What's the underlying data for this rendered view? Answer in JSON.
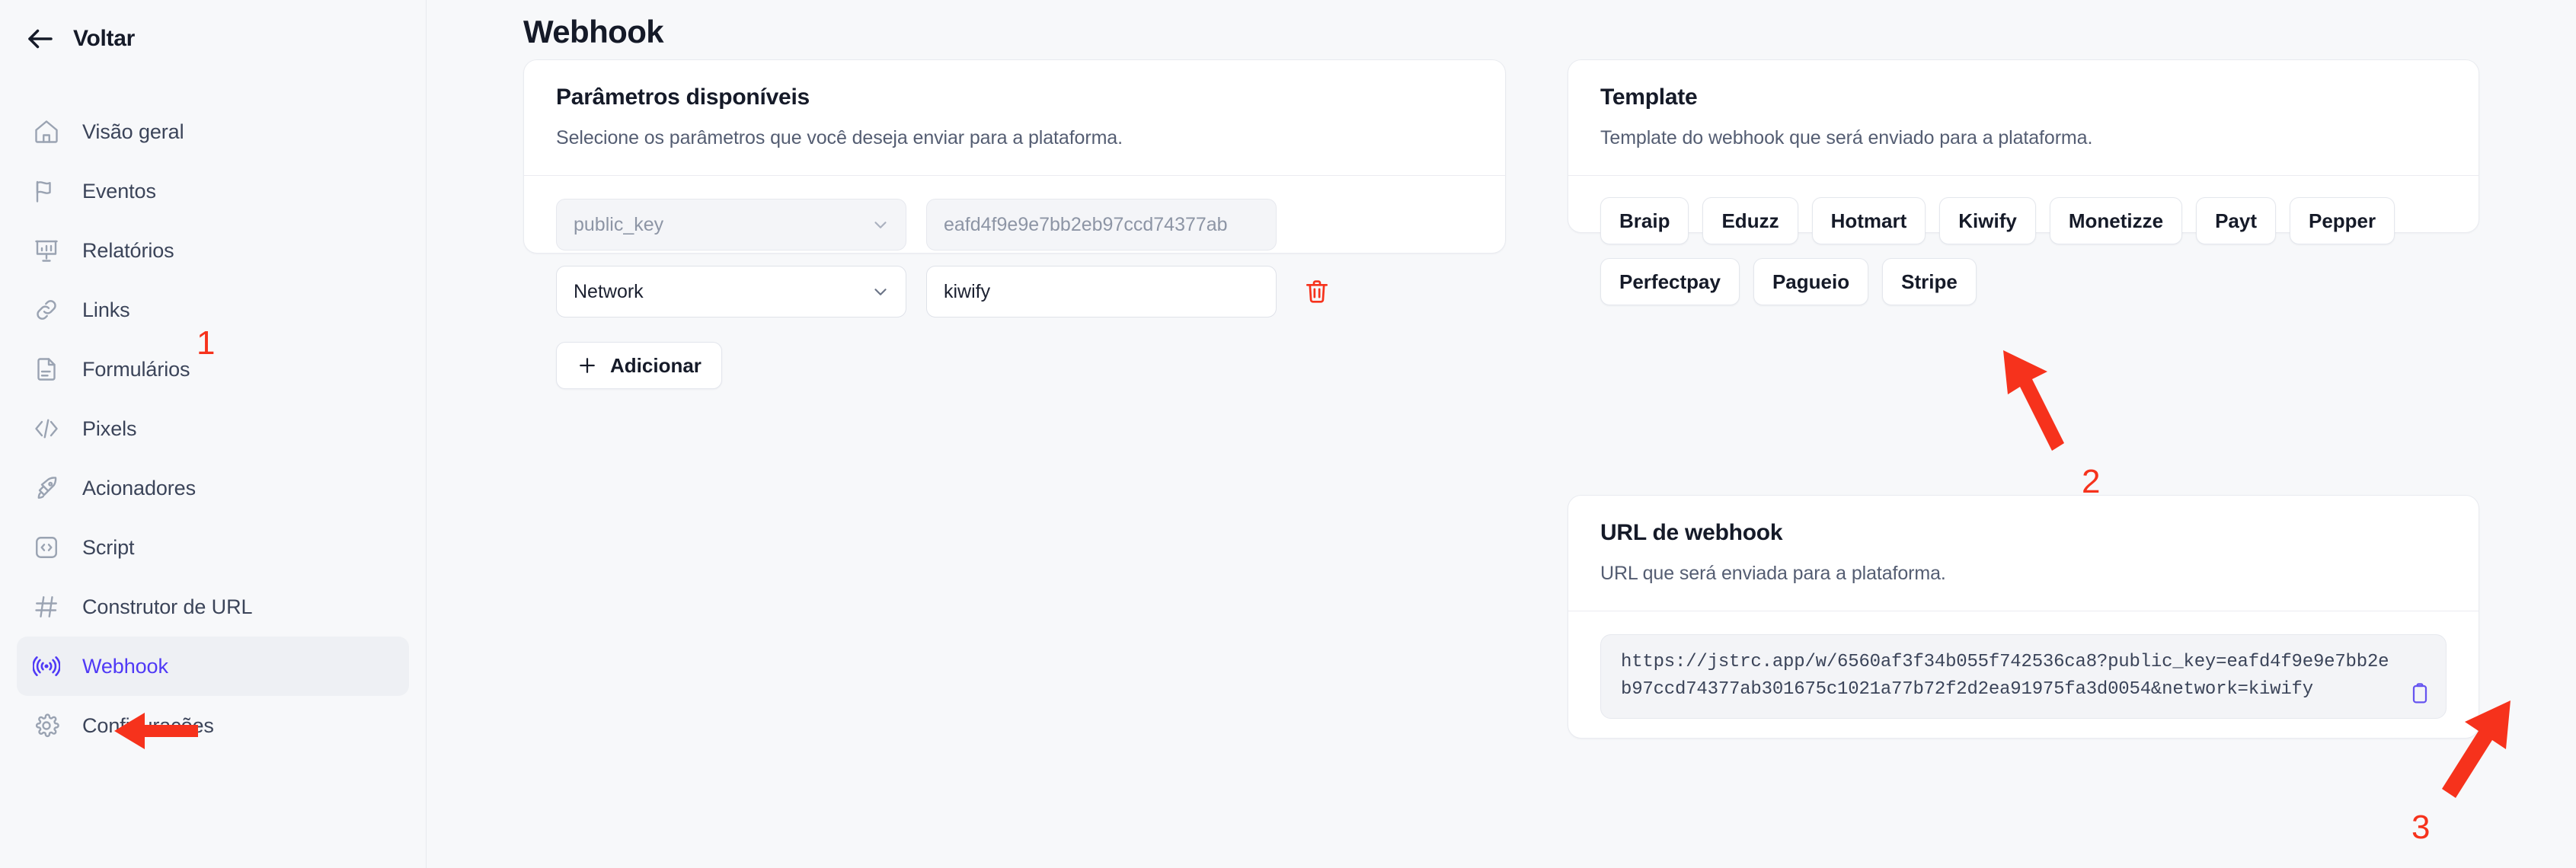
{
  "sidebar": {
    "back_label": "Voltar",
    "back_icon": "arrow-left-icon",
    "items": [
      {
        "label": "Visão geral",
        "icon": "home-icon",
        "active": false
      },
      {
        "label": "Eventos",
        "icon": "flag-icon",
        "active": false
      },
      {
        "label": "Relatórios",
        "icon": "presentation-chart-icon",
        "active": false
      },
      {
        "label": "Links",
        "icon": "link-chain-icon",
        "active": false
      },
      {
        "label": "Formulários",
        "icon": "document-icon",
        "active": false
      },
      {
        "label": "Pixels",
        "icon": "code-slash-icon",
        "active": false
      },
      {
        "label": "Acionadores",
        "icon": "rocket-icon",
        "active": false
      },
      {
        "label": "Script",
        "icon": "code-box-icon",
        "active": false
      },
      {
        "label": "Construtor de URL",
        "icon": "hash-icon",
        "active": false
      },
      {
        "label": "Webhook",
        "icon": "broadcast-icon",
        "active": true
      },
      {
        "label": "Configurações",
        "icon": "gear-icon",
        "active": false
      }
    ]
  },
  "header": {
    "title": "Webhook"
  },
  "params_card": {
    "title": "Parâmetros disponíveis",
    "subtitle": "Selecione os parâmetros que você deseja enviar para a plataforma.",
    "rows": [
      {
        "param": "public_key",
        "value": "eafd4f9e9e7bb2eb97ccd74377ab",
        "disabled": true,
        "deletable": false
      },
      {
        "param": "Network",
        "value": "kiwify",
        "disabled": false,
        "deletable": true,
        "delete_icon": "trash-icon"
      }
    ],
    "add_label": "Adicionar",
    "add_icon": "plus-icon"
  },
  "template_card": {
    "title": "Template",
    "subtitle": "Template do webhook que será enviado para a plataforma.",
    "platforms": [
      "Braip",
      "Eduzz",
      "Hotmart",
      "Kiwify",
      "Monetizze",
      "Payt",
      "Pepper",
      "Perfectpay",
      "Pagueio",
      "Stripe"
    ]
  },
  "url_card": {
    "title": "URL de webhook",
    "subtitle": "URL que será enviada para a plataforma.",
    "url": "https://jstrc.app/w/6560af3f34b055f742536ca8?public_key=eafd4f9e9e7bb2eb97ccd74377ab301675c1021a77b72f2d2ea91975fa3d0054&network=kiwify",
    "copy_icon": "clipboard-copy-icon"
  },
  "annotations": {
    "color": "#f6321c",
    "markers": [
      {
        "number": "1",
        "target": "sidebar-item-webhook"
      },
      {
        "number": "2",
        "target": "platform-chip-kiwify"
      },
      {
        "number": "3",
        "target": "copy-url-button"
      }
    ]
  },
  "colors": {
    "accent": "#4f39f6",
    "annotation": "#f6321c",
    "page_bg": "#f7f8fa",
    "card_bg": "#ffffff"
  }
}
